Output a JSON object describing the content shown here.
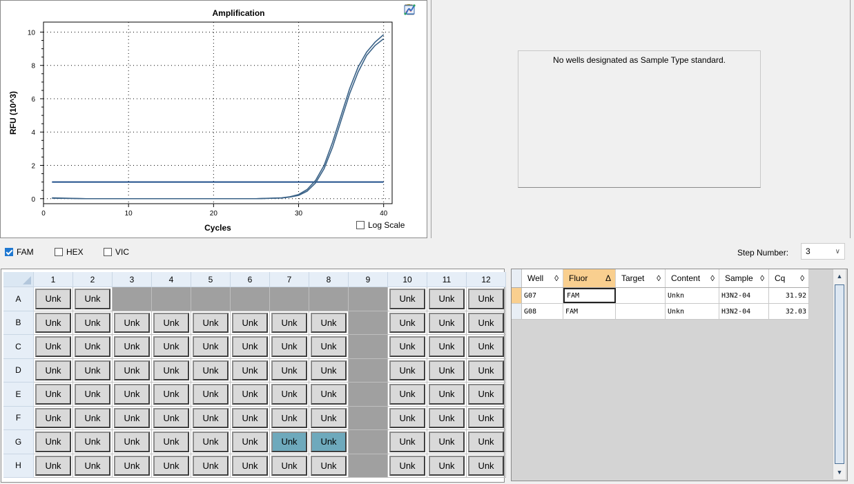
{
  "chart_panel": {
    "tools": [
      "copy-icon",
      "chart-settings-icon",
      "export-icon",
      "chart-image-icon",
      "curve-icon"
    ],
    "log_scale_label": "Log Scale",
    "log_scale_checked": false
  },
  "chart_data": {
    "type": "line",
    "title": "Amplification",
    "xlabel": "Cycles",
    "ylabel": "RFU (10^3)",
    "xlim": [
      0,
      41
    ],
    "ylim": [
      -0.3,
      10.6
    ],
    "xticks": [
      0,
      10,
      20,
      30,
      40
    ],
    "yticks": [
      0,
      2,
      4,
      6,
      8,
      10
    ],
    "grid": true,
    "threshold": 1.0,
    "series": [
      {
        "values_x": [
          1,
          5,
          10,
          15,
          20,
          25,
          28,
          29,
          30,
          31,
          32,
          33,
          34,
          35,
          36,
          37,
          38,
          39,
          40
        ],
        "values_y": [
          0.05,
          0.0,
          0.0,
          0.0,
          0.0,
          0.0,
          0.05,
          0.12,
          0.25,
          0.55,
          1.1,
          2.0,
          3.4,
          5.0,
          6.6,
          7.9,
          8.8,
          9.4,
          9.85
        ]
      },
      {
        "values_x": [
          1,
          5,
          10,
          15,
          20,
          25,
          28,
          29,
          30,
          31,
          32,
          33,
          34,
          35,
          36,
          37,
          38,
          39,
          40
        ],
        "values_y": [
          0.03,
          0.0,
          0.0,
          0.0,
          0.0,
          0.0,
          0.04,
          0.1,
          0.2,
          0.45,
          0.95,
          1.8,
          3.1,
          4.7,
          6.3,
          7.6,
          8.6,
          9.2,
          9.6
        ]
      }
    ],
    "colors": {
      "curve": "#3a6287",
      "threshold": "#1f4e8a"
    }
  },
  "standard_curve": {
    "message": "No wells designated as Sample Type standard."
  },
  "fluorophores": [
    {
      "label": "FAM",
      "checked": true
    },
    {
      "label": "HEX",
      "checked": false
    },
    {
      "label": "VIC",
      "checked": false
    }
  ],
  "step": {
    "label": "Step Number:",
    "value": "3"
  },
  "plate": {
    "columns": [
      "1",
      "2",
      "3",
      "4",
      "5",
      "6",
      "7",
      "8",
      "9",
      "10",
      "11",
      "12"
    ],
    "rows": [
      "A",
      "B",
      "C",
      "D",
      "E",
      "F",
      "G",
      "H"
    ],
    "well_label": "Unk",
    "empty_wells": [
      "A3",
      "A4",
      "A5",
      "A6",
      "A7",
      "A8",
      "A9",
      "B9",
      "C9",
      "D9",
      "E9",
      "F9",
      "G9",
      "H9"
    ],
    "selected_wells": [
      "G7",
      "G8"
    ]
  },
  "results_table": {
    "columns": [
      {
        "label": "Well",
        "sort": "◊"
      },
      {
        "label": "Fluor",
        "sort": "Δ"
      },
      {
        "label": "Target",
        "sort": "◊"
      },
      {
        "label": "Content",
        "sort": "◊"
      },
      {
        "label": "Sample",
        "sort": "◊"
      },
      {
        "label": "Cq",
        "sort": "◊"
      }
    ],
    "rows": [
      [
        "G07",
        "FAM",
        "",
        "Unkn",
        "H3N2-04",
        "31.92"
      ],
      [
        "G08",
        "FAM",
        "",
        "Unkn",
        "H3N2-04",
        "32.03"
      ]
    ]
  }
}
